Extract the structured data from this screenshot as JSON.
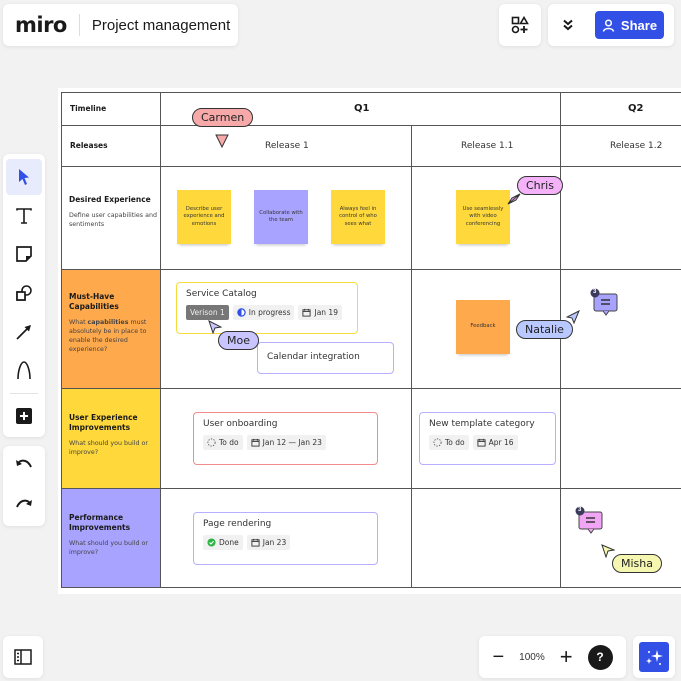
{
  "app": {
    "logo": "miro",
    "board_title": "Project management"
  },
  "header": {
    "share_label": "Share",
    "icons": {
      "shapes": "shapes-plus-icon",
      "collapse": "double-chevron-down-icon",
      "share": "user-icon"
    }
  },
  "toolbar": {
    "tools": [
      {
        "name": "select",
        "icon": "cursor-arrow-icon",
        "active": true
      },
      {
        "name": "text",
        "icon": "text-icon"
      },
      {
        "name": "sticky-note",
        "icon": "sticky-note-icon"
      },
      {
        "name": "shapes",
        "icon": "shapes-icon"
      },
      {
        "name": "connection-line",
        "icon": "arrow-line-icon"
      },
      {
        "name": "pen",
        "icon": "pen-icon"
      },
      {
        "name": "more",
        "icon": "plus-square-icon"
      }
    ],
    "undo": "undo-icon",
    "redo": "redo-icon"
  },
  "bottom": {
    "zoom_level": "100%",
    "zoom_out": "−",
    "zoom_in": "+",
    "help": "?"
  },
  "board": {
    "header_labels": {
      "timeline": "Timeline",
      "releases": "Releases"
    },
    "quarters": [
      "Q1",
      "Q2"
    ],
    "releases": [
      "Release 1",
      "Release 1.1",
      "Release 1.2"
    ],
    "rows": [
      {
        "title": "Desired Experience",
        "desc": "Define user capabilities and sentiments",
        "color": "#ffffff"
      },
      {
        "title": "Must-Have Capabilities",
        "desc_pre": "What ",
        "desc_bold": "capabilities",
        "desc_post": " must absolutely be in place to enable the desired experience?",
        "color": "#ffa94d"
      },
      {
        "title": "User Experience Improvements",
        "desc": "What should you build or improve?",
        "color": "#ffd93b"
      },
      {
        "title": "Performance Improvements",
        "desc": "What should you build or improve?",
        "color": "#a8a3ff"
      }
    ],
    "stickies": [
      {
        "text": "Describe user experience and emotions",
        "color": "#ffd93b"
      },
      {
        "text": "Collaborate with the team",
        "color": "#a8a3ff"
      },
      {
        "text": "Always feel in control of who sees what",
        "color": "#ffd93b"
      },
      {
        "text": "Use seamlessly with video conferencing",
        "color": "#ffd93b"
      },
      {
        "text": "Feedback",
        "color": "#ffa94d"
      }
    ],
    "cards": [
      {
        "title": "Service Catalog",
        "border": "#f5dc3c",
        "chips": [
          {
            "type": "version",
            "text": "Verison 1"
          },
          {
            "type": "status",
            "icon": "half-circle-icon",
            "text": "In progress"
          },
          {
            "type": "date",
            "icon": "calendar-icon",
            "text": "Jan 19"
          }
        ]
      },
      {
        "title": "Calendar integration",
        "border": "#b6b0ff",
        "chips": []
      },
      {
        "title": "User onboarding",
        "border": "#f28b8b",
        "chips": [
          {
            "type": "status",
            "icon": "dashed-circle-icon",
            "text": "To do"
          },
          {
            "type": "date",
            "icon": "calendar-icon",
            "text": "Jan 12 — Jan 23"
          }
        ]
      },
      {
        "title": "New template category",
        "border": "#b6b0ff",
        "chips": [
          {
            "type": "status",
            "icon": "dashed-circle-icon",
            "text": "To do"
          },
          {
            "type": "date",
            "icon": "calendar-icon",
            "text": "Apr 16"
          }
        ]
      },
      {
        "title": "Page rendering",
        "border": "#b6b0ff",
        "chips": [
          {
            "type": "status",
            "icon": "check-circle-icon",
            "text": "Done"
          },
          {
            "type": "date",
            "icon": "calendar-icon",
            "text": "Jan 23"
          }
        ]
      }
    ],
    "collaborators": [
      {
        "name": "Carmen",
        "color": "#f7a8a8"
      },
      {
        "name": "Chris",
        "color": "#f4b3f9"
      },
      {
        "name": "Moe",
        "color": "#c9c6ff"
      },
      {
        "name": "Natalie",
        "color": "#b9c8ff"
      },
      {
        "name": "Misha",
        "color": "#f5f7b0"
      }
    ],
    "comments": [
      {
        "count": "3",
        "color": "#a8a3ff"
      },
      {
        "count": "3",
        "color": "#f0a6f5"
      }
    ]
  },
  "colors": {
    "accent": "#3250e6",
    "canvas": "#f2f2f2"
  }
}
